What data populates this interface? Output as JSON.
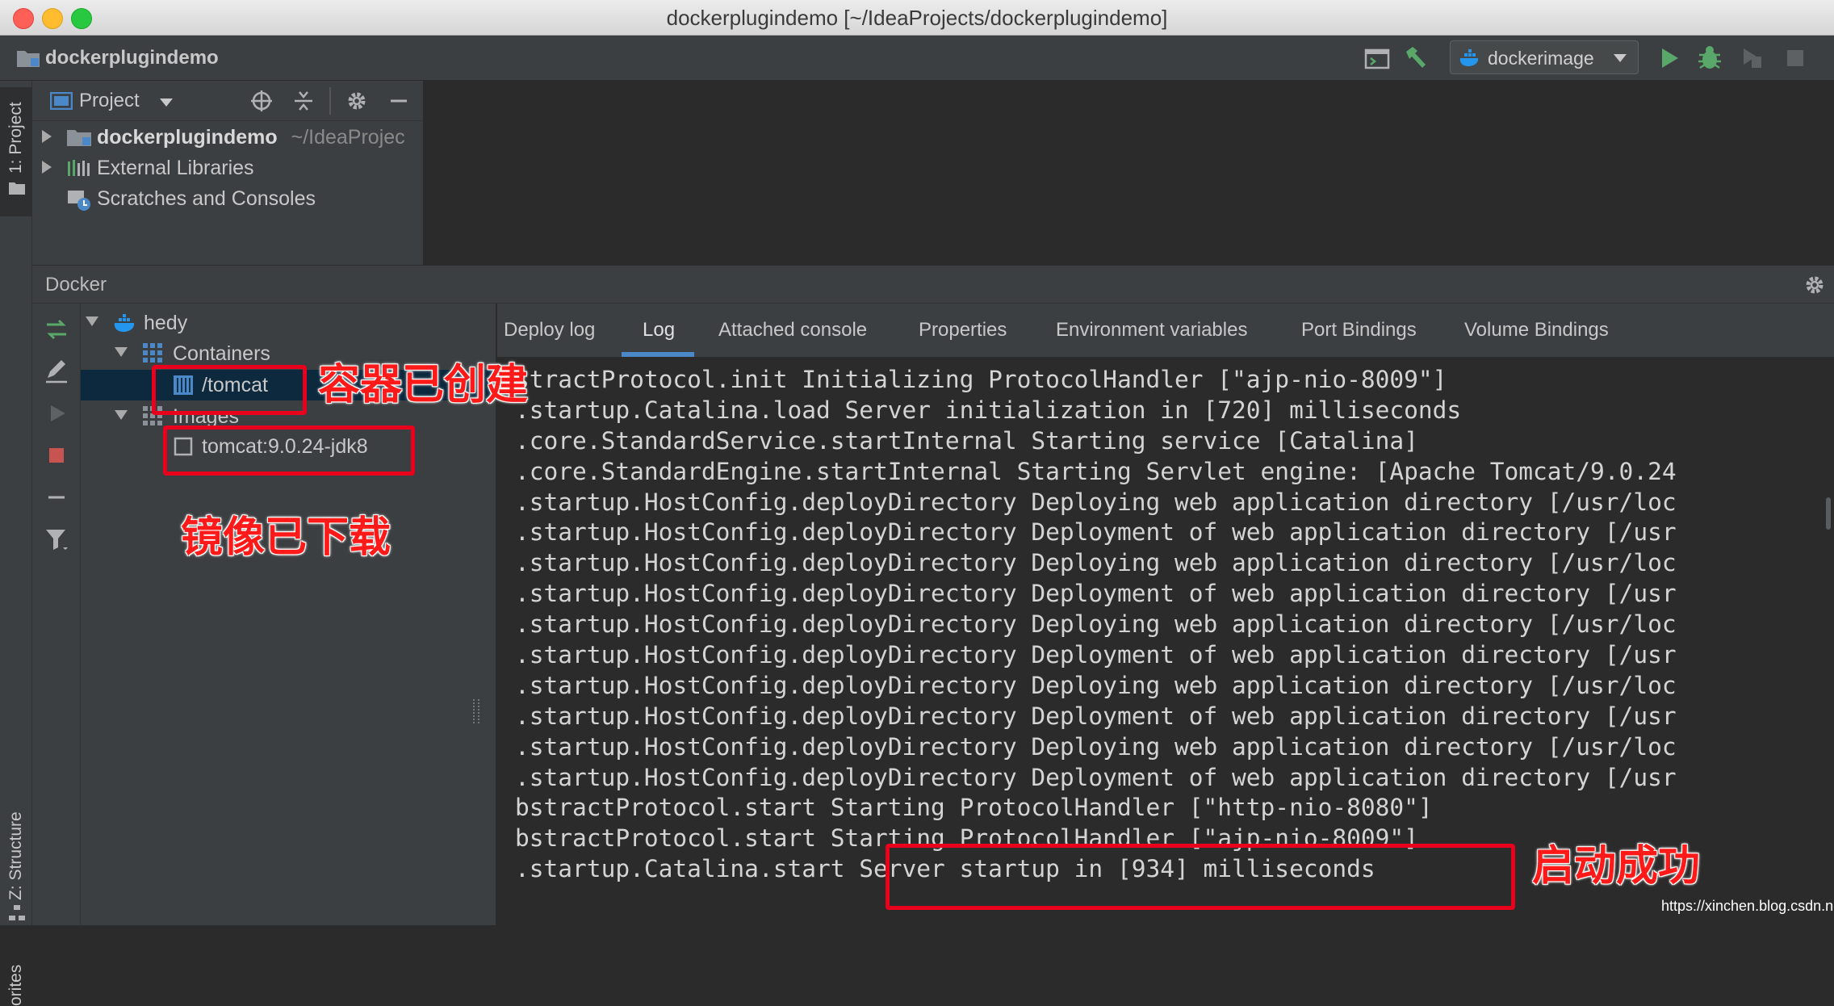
{
  "window": {
    "title": "dockerplugindemo [~/IdeaProjects/dockerplugindemo]"
  },
  "navbar": {
    "breadcrumb": "dockerplugindemo",
    "run_config": "dockerimage"
  },
  "left_strip": {
    "tab_project": "1: Project",
    "tab_structure": "Z: Structure",
    "tab_favorites": "orites"
  },
  "project_panel": {
    "title": "Project",
    "items": [
      {
        "label": "dockerplugindemo",
        "hint": "~/IdeaProjec"
      },
      {
        "label": "External Libraries"
      },
      {
        "label": "Scratches and Consoles"
      }
    ]
  },
  "docker_panel": {
    "title": "Docker",
    "tree": {
      "root": "hedy",
      "containers_label": "Containers",
      "container_item": "/tomcat",
      "images_label": "Images",
      "image_item": "tomcat:9.0.24-jdk8"
    },
    "tabs": [
      "Deploy log",
      "Log",
      "Attached console",
      "Properties",
      "Environment variables",
      "Port Bindings",
      "Volume Bindings"
    ],
    "active_tab": "Log",
    "log_lines": [
      "stractProtocol.init Initializing ProtocolHandler [\"ajp-nio-8009\"]",
      ".startup.Catalina.load Server initialization in [720] milliseconds",
      ".core.StandardService.startInternal Starting service [Catalina]",
      ".core.StandardEngine.startInternal Starting Servlet engine: [Apache Tomcat/9.0.24",
      ".startup.HostConfig.deployDirectory Deploying web application directory [/usr/loc",
      ".startup.HostConfig.deployDirectory Deployment of web application directory [/usr",
      ".startup.HostConfig.deployDirectory Deploying web application directory [/usr/loc",
      ".startup.HostConfig.deployDirectory Deployment of web application directory [/usr",
      ".startup.HostConfig.deployDirectory Deploying web application directory [/usr/loc",
      ".startup.HostConfig.deployDirectory Deployment of web application directory [/usr",
      ".startup.HostConfig.deployDirectory Deploying web application directory [/usr/loc",
      ".startup.HostConfig.deployDirectory Deployment of web application directory [/usr",
      ".startup.HostConfig.deployDirectory Deploying web application directory [/usr/loc",
      ".startup.HostConfig.deployDirectory Deployment of web application directory [/usr",
      "bstractProtocol.start Starting ProtocolHandler [\"http-nio-8080\"]",
      "bstractProtocol.start Starting ProtocolHandler [\"ajp-nio-8009\"]",
      ".startup.Catalina.start Server startup in [934] milliseconds"
    ]
  },
  "annotations": {
    "container_created": "容器已创建",
    "image_downloaded": "镜像已下载",
    "startup_success": "启动成功"
  },
  "watermark": "https://xinchen.blog.csdn.net",
  "colors": {
    "accent": "#4a88c7",
    "annotation_red": "#e8001c",
    "run_green": "#59a869",
    "stop_red": "#c75450"
  }
}
